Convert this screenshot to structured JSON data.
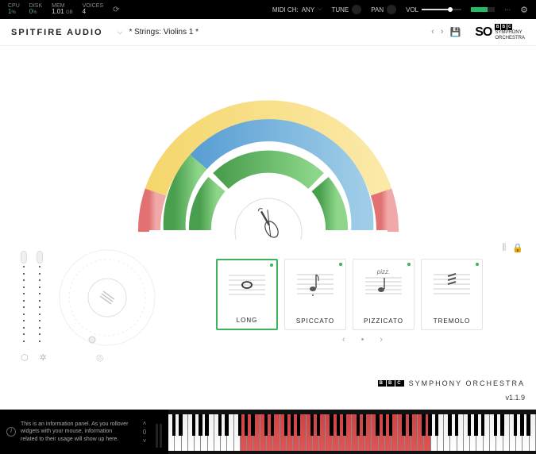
{
  "topbar": {
    "cpu": {
      "label": "CPU",
      "value": "1",
      "unit": "%"
    },
    "disk": {
      "label": "DISK",
      "value": "0",
      "unit": "%"
    },
    "mem": {
      "label": "MEM",
      "value": "1.01",
      "unit": "GB"
    },
    "voices": {
      "label": "VOICES",
      "value": "4"
    },
    "midi_ch": {
      "label": "MIDI CH:",
      "value": "ANY"
    },
    "tune": "TUNE",
    "pan": "PAN",
    "vol": "VOL"
  },
  "header": {
    "brand": "SPITFIRE AUDIO",
    "preset": "* Strings: Violins 1 *",
    "logo": {
      "so": "SO",
      "bbc": [
        "B",
        "B",
        "C"
      ],
      "line1": "Symphony",
      "line2": "Orchestra"
    }
  },
  "center_instrument": "violin",
  "articulations": [
    {
      "id": "long",
      "label": "LONG",
      "active": true
    },
    {
      "id": "spiccato",
      "label": "SPICCATO",
      "active": false
    },
    {
      "id": "pizzicato",
      "label": "PIZZICATO",
      "active": false,
      "marking": "pizz."
    },
    {
      "id": "tremolo",
      "label": "TREMOLO",
      "active": false
    }
  ],
  "artic_nav": {
    "prev": "‹",
    "dot": "•",
    "next": "›"
  },
  "footer": {
    "bbc": [
      "B",
      "B",
      "C"
    ],
    "text": "SYMPHONY ORCHESTRA",
    "version": "v1.1.9"
  },
  "info_panel": "This is an information panel. As you rollover widgets with your mouse, information related to their usage will show up here.",
  "octave": "0",
  "keyboard": {
    "white_keys": 56,
    "active_range": [
      11,
      39
    ]
  }
}
